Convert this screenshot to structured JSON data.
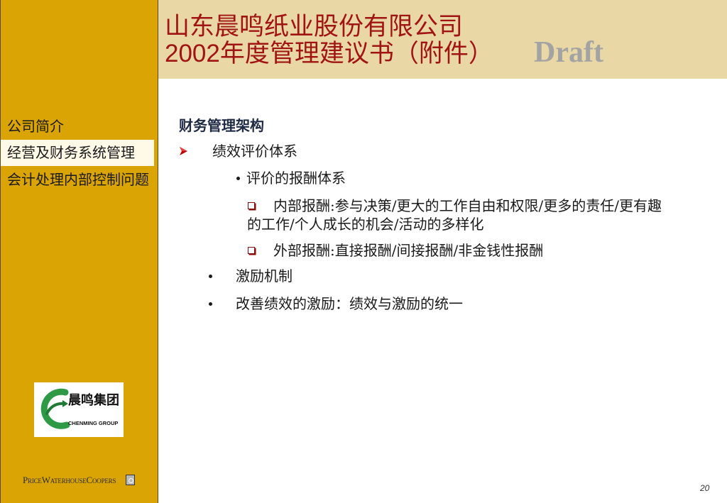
{
  "slide": {
    "title_line1": "山东晨鸣纸业股份有限公司",
    "title_line2": "2002年度管理建议书（附件）",
    "watermark": "Draft",
    "page_number": "20"
  },
  "sidebar": {
    "items": [
      {
        "label": "公司简介",
        "active": false
      },
      {
        "label": "经营及财务系统管理",
        "active": true
      },
      {
        "label": "会计处理内部控制问题",
        "active": false
      }
    ]
  },
  "content": {
    "heading": "财务管理架构",
    "level1": {
      "label": "绩效评价体系"
    },
    "level2": {
      "label": "评价的报酬体系"
    },
    "level3": [
      {
        "label": "内部报酬:参与决策/更大的工作自由和权限/更多的责任/更有趣的工作/个人成长的机会/活动的多样化"
      },
      {
        "label": "外部报酬:直接报酬/间接报酬/非金钱性报酬"
      }
    ],
    "points": [
      "激励机制",
      "改善绩效的激励：绩效与激励的统一"
    ]
  },
  "logos": {
    "company": {
      "name_cn": "晨鸣集团",
      "name_en": "CHENMING GROUP"
    },
    "firm": {
      "name": "PriceWaterhouseCoopers"
    }
  },
  "icons": {
    "level1_bullet": "arrow-bullet-icon",
    "level2_bullet": "dot-bullet-icon",
    "level3_bullet": "square-bullet-icon",
    "point_bullet": "dot-bullet-icon",
    "company_logo": "chenming-logo-icon",
    "firm_logo_mark": "pwc-mark-icon"
  },
  "colors": {
    "sidebar": "#D9A404",
    "header": "#E9D7A6",
    "title": "#A01414",
    "watermark": "#A3A3A3",
    "heading": "#1F2A44",
    "bullet_accent": "#C00000",
    "logo_green": "#2E9A46",
    "active_item": "#FFFAE8"
  }
}
